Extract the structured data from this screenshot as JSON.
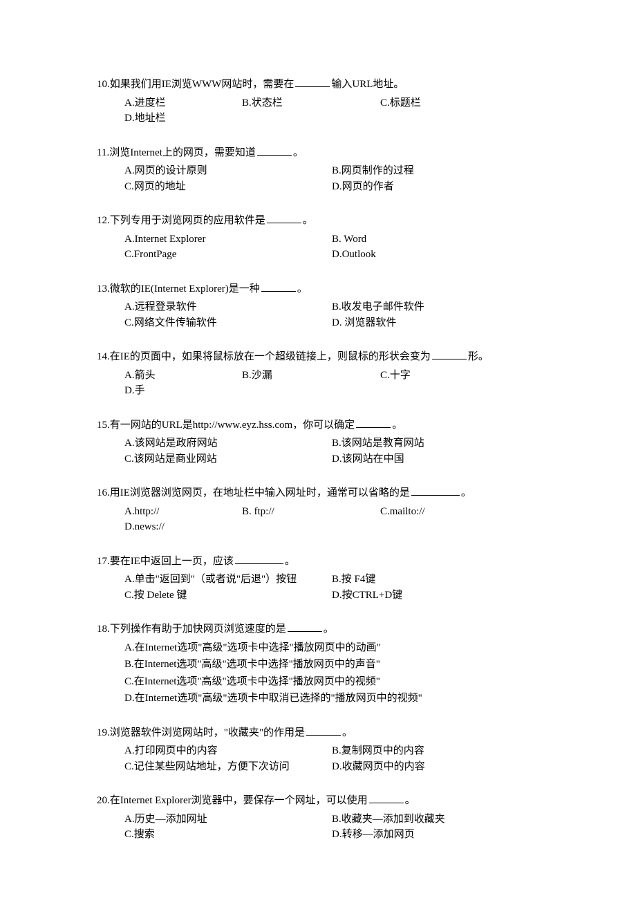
{
  "questions": [
    {
      "num": "10.",
      "text_pre": "如果我们用IE浏览WWW网站时，需要在",
      "text_post": "输入URL地址。",
      "layout": "4",
      "opts": {
        "a": "A.进度栏",
        "b": "B.状态栏",
        "c": "C.标题栏",
        "d": "D.地址栏"
      }
    },
    {
      "num": "11.",
      "text_pre": "浏览Internet上的网页，需要知道",
      "text_post": "。",
      "layout": "2col",
      "opts": {
        "a": "A.网页的设计原则",
        "b": "B.网页制作的过程",
        "c": "C.网页的地址",
        "d": "D.网页的作者"
      }
    },
    {
      "num": "12.",
      "text_pre": "下列专用于浏览网页的应用软件是",
      "text_post": "。",
      "layout": "2col",
      "opts": {
        "a": "A.Internet Explorer",
        "b": "B. Word",
        "c": "C.FrontPage",
        "d": "D.Outlook"
      }
    },
    {
      "num": "13.",
      "text_pre": "微软的IE(Internet Explorer)是一种",
      "text_post": "。",
      "layout": "2col",
      "opts": {
        "a": "A.远程登录软件",
        "b": "B.收发电子邮件软件",
        "c": "C.网络文件传输软件",
        "d": "D. 浏览器软件"
      }
    },
    {
      "num": "14.",
      "text_pre": "在IE的页面中，如果将鼠标放在一个超级链接上，则鼠标的形状会变为",
      "text_post": "形。",
      "layout": "4",
      "opts": {
        "a": "A.箭头",
        "b": "B.沙漏",
        "c": "C.十字",
        "d": "D.手"
      }
    },
    {
      "num": "15.",
      "text_pre": "有一网站的URL是http://www.eyz.hss.com，你可以确定",
      "text_post": "。",
      "layout": "2col",
      "opts": {
        "a": "A.该网站是政府网站",
        "b": "B.该网站是教育网站",
        "c": "C.该网站是商业网站",
        "d": "D.该网站在中国"
      }
    },
    {
      "num": "16.",
      "text_pre": "用IE浏览器浏览网页，在地址栏中输入网址时，通常可以省略的是",
      "text_post": "。",
      "layout": "4",
      "opts": {
        "a": "A.http://",
        "b": "B. ftp://",
        "c": "C.mailto://",
        "d": "D.news://"
      }
    },
    {
      "num": "17.",
      "text_pre": "要在IE中返回上一页，应该",
      "text_post": "。",
      "layout": "2col",
      "opts": {
        "a": "A.单击\"返回到\"（或者说\"后退\"）按钮",
        "b": "B.按 F4键",
        "c": "C.按 Delete 键",
        "d": "D.按CTRL+D键"
      }
    },
    {
      "num": "18.",
      "text_pre": "下列操作有助于加快网页浏览速度的是",
      "text_post": "。",
      "layout": "stack",
      "opts": {
        "a": "A.在Internet选项\"高级\"选项卡中选择\"播放网页中的动画\"",
        "b": "B.在Internet选项\"高级\"选项卡中选择\"播放网页中的声音\"",
        "c": "C.在Internet选项\"高级\"选项卡中选择\"播放网页中的视频\"",
        "d": "D.在Internet选项\"高级\"选项卡中取消已选择的\"播放网页中的视频\""
      }
    },
    {
      "num": "19.",
      "text_pre": "浏览器软件浏览网站时，\"收藏夹\"的作用是",
      "text_post": "。",
      "layout": "2col",
      "opts": {
        "a": "A.打印网页中的内容",
        "b": "B.复制网页中的内容",
        "c": "C.记住某些网站地址，方便下次访问",
        "d": "D.收藏网页中的内容"
      }
    },
    {
      "num": "20.",
      "text_pre": "在Internet Explorer浏览器中，要保存一个网址，可以使用",
      "text_post": "。",
      "layout": "2col",
      "opts": {
        "a": "A.历史—添加网址",
        "b": "B.收藏夹—添加到收藏夹",
        "c": "C.搜索",
        "d": "D.转移—添加网页"
      }
    }
  ]
}
